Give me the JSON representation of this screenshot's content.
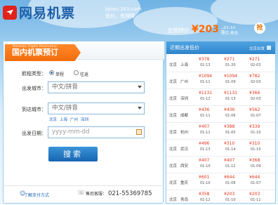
{
  "brand": {
    "logo_text": "网易机票",
    "domain": "jipiao.163.com",
    "slogan": "低价，有保障"
  },
  "promo": {
    "label": "全国特价",
    "price": "¥203",
    "unit": "元",
    "date": "01-10",
    "route": "北京-青岛",
    "grab_label": "抢"
  },
  "form": {
    "subtitle_en": "Domestic Flights Reservation",
    "tab_label": "国内机票预订",
    "trip_type_label": "航程类型：",
    "trip_options": [
      "单程",
      "往返"
    ],
    "from_label": "出发城市：",
    "from_placeholder": "中文/拼音",
    "to_label": "到达城市：",
    "to_placeholder": "中文/拼音",
    "hot_cities": [
      "北京",
      "上海",
      "广州",
      "深圳"
    ],
    "date_label": "出发日期：",
    "date_placeholder": "yyyy-mm-dd",
    "search_label": "搜索",
    "learn_link": "了解支付方式",
    "hotline_label": "售后客服：",
    "hotline_number": "021-55369785"
  },
  "prices": {
    "title": "近期出发低价",
    "city": "北京出发",
    "rows": [
      {
        "from": "北京",
        "to": "上海",
        "p": [
          "¥378",
          "¥271",
          "¥271"
        ],
        "d": [
          "01-13",
          "01-20",
          "02-03"
        ]
      },
      {
        "from": "北京",
        "to": "广州",
        "p": [
          "¥1094",
          "¥1094",
          "¥782"
        ],
        "d": [
          "01-11",
          "01-09",
          "02-03"
        ]
      },
      {
        "from": "北京",
        "to": "深圳",
        "p": [
          "¥1131",
          "¥1131",
          "¥366"
        ],
        "d": [
          "01-12",
          "01-13",
          "02-03"
        ]
      },
      {
        "from": "北京",
        "to": "成都",
        "p": [
          "¥436",
          "¥436",
          "¥562"
        ],
        "d": [
          "01-11",
          "01-06",
          "01-07"
        ]
      },
      {
        "from": "北京",
        "to": "杭州",
        "p": [
          "¥407",
          "¥388",
          "¥339"
        ],
        "d": [
          "01-11",
          "01-05",
          "01-10"
        ]
      },
      {
        "from": "北京",
        "to": "武汉",
        "p": [
          "¥496",
          "¥310",
          "¥310"
        ],
        "d": [
          "01-13",
          "01-14",
          "01-15"
        ]
      },
      {
        "from": "北京",
        "to": "西安",
        "p": [
          "¥407",
          "¥407",
          "¥368"
        ],
        "d": [
          "01-10",
          "01-12",
          "01-09"
        ]
      },
      {
        "from": "北京",
        "to": "重庆",
        "p": [
          "¥601",
          "¥644",
          "¥644"
        ],
        "d": [
          "01-10",
          "01-06",
          "01-07"
        ]
      },
      {
        "from": "北京",
        "to": "青岛",
        "p": [
          "¥358",
          "¥203",
          "¥203"
        ],
        "d": [
          "01-12",
          "01-10",
          "01-11"
        ]
      }
    ]
  },
  "colors": {
    "accent": "#f36b0c",
    "link": "#1a62b8",
    "price": "#e3341b",
    "header_blue": "#2f84cc"
  }
}
